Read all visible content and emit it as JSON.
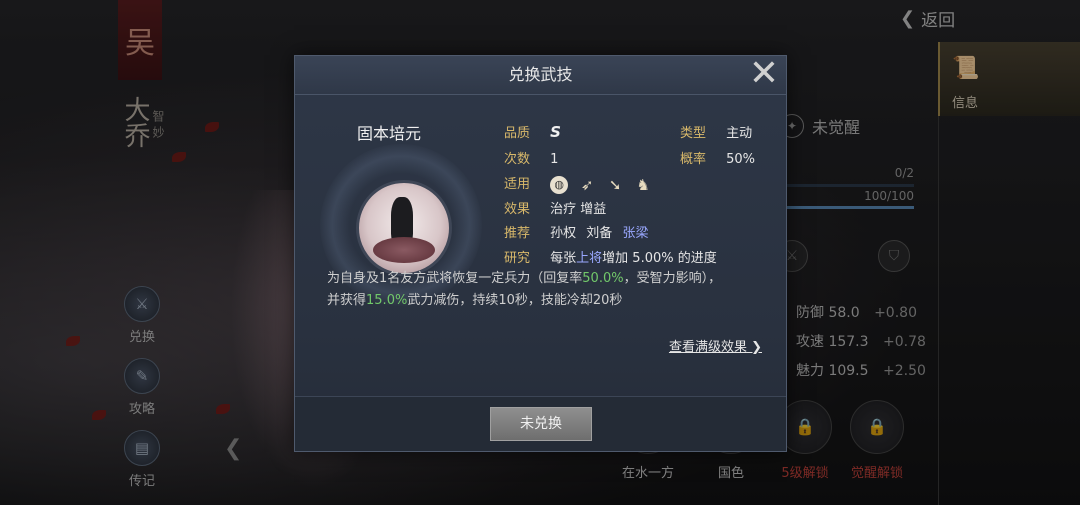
{
  "hero": {
    "banner_char": "吴",
    "name": "大乔",
    "trait": "智妙"
  },
  "left_menu": [
    {
      "label": "兑换",
      "icon": "exchange-icon"
    },
    {
      "label": "攻略",
      "icon": "guide-icon"
    },
    {
      "label": "传记",
      "icon": "biography-icon"
    }
  ],
  "right_panel": {
    "back_label": "返回",
    "info_tab_label": "信息",
    "awaken_status": "未觉醒",
    "bar1_text": "0/2",
    "bar1_fill": 0,
    "bar2_text": "100/100",
    "bar2_fill": 1.0,
    "stats": [
      {
        "label": "防御",
        "value": "58.0",
        "plus": "+0.80"
      },
      {
        "label": "攻速",
        "value": "157.3",
        "plus": "+0.78"
      },
      {
        "label": "魅力",
        "value": "109.5",
        "plus": "+2.50"
      }
    ],
    "bottom_buttons": [
      {
        "label": "在水一方",
        "color": "#c8c8c8"
      },
      {
        "label": "国色",
        "color": "#c8c8c8"
      },
      {
        "label": "5级解锁",
        "color": "#c0413a"
      },
      {
        "label": "觉醒解锁",
        "color": "#c0413a"
      }
    ]
  },
  "modal": {
    "title": "兑换武技",
    "skill_name": "固本培元",
    "labels": {
      "quality": "品质",
      "type": "类型",
      "count": "次数",
      "rate": "概率",
      "applicable": "适用",
      "effect": "效果",
      "recommend": "推荐",
      "research": "研究"
    },
    "values": {
      "quality": "S",
      "type": "主动",
      "count": "1",
      "rate": "50%",
      "effect": "治疗 增益",
      "recommend_1": "孙权",
      "recommend_2": "刘备",
      "recommend_3": "张梁",
      "research_pre": "每张",
      "research_mid": "上将",
      "research_post": "增加 5.00% 的进度"
    },
    "applicable_icons": [
      "shield-icon",
      "bow-icon",
      "spear-icon",
      "horse-icon"
    ],
    "desc": {
      "line1_pre": "为自身及1名友方武将恢复一定兵力（回复率",
      "line1_green": "50.0%",
      "line1_post": "，受智力影响），",
      "line2_pre": "并获得",
      "line2_green": "15.0%",
      "line2_post": "武力减伤，持续10秒，技能冷却20秒"
    },
    "full_effect_link": "查看满级效果",
    "redeem_button": "未兑换"
  }
}
